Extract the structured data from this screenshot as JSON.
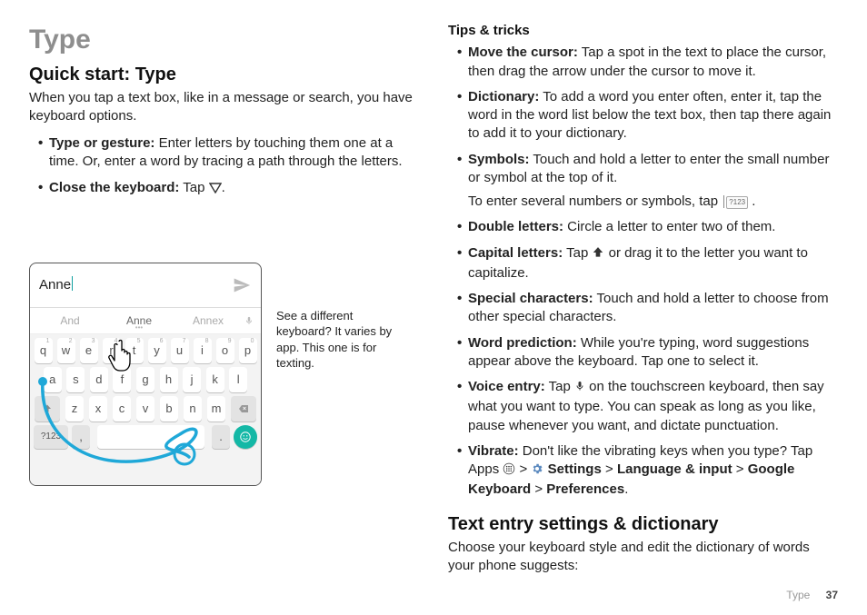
{
  "page_section": "Type",
  "page_number": "37",
  "left": {
    "title": "Type",
    "quick_start_heading": "Quick start: Type",
    "quick_start_body": "When you tap a text box, like in a message or search, you have keyboard options.",
    "bullets": [
      {
        "bold": "Type or gesture:",
        "rest": " Enter letters by touching them one at a time. Or, enter a word by tracing a path through the letters."
      },
      {
        "bold": "Close the keyboard:",
        "rest": " Tap "
      }
    ],
    "caption": "See a different keyboard? It varies by app. This one is for texting.",
    "keyboard": {
      "input_text": "Anne",
      "suggestions": [
        "And",
        "Anne",
        "Annex"
      ],
      "row1": [
        {
          "k": "q",
          "n": "1"
        },
        {
          "k": "w",
          "n": "2"
        },
        {
          "k": "e",
          "n": "3"
        },
        {
          "k": "r",
          "n": "4"
        },
        {
          "k": "t",
          "n": "5"
        },
        {
          "k": "y",
          "n": "6"
        },
        {
          "k": "u",
          "n": "7"
        },
        {
          "k": "i",
          "n": "8"
        },
        {
          "k": "o",
          "n": "9"
        },
        {
          "k": "p",
          "n": "0"
        }
      ],
      "row2": [
        "a",
        "s",
        "d",
        "f",
        "g",
        "h",
        "j",
        "k",
        "l"
      ],
      "row3": [
        "z",
        "x",
        "c",
        "v",
        "b",
        "n",
        "m"
      ],
      "sym_key": "?123"
    }
  },
  "right": {
    "tips_heading": "Tips & tricks",
    "tips": [
      {
        "bold": "Move the cursor:",
        "rest": " Tap a spot in the text to place the cursor, then drag the arrow under the cursor to move it."
      },
      {
        "bold": "Dictionary:",
        "rest": " To add a word you enter often, enter it, tap the word in the word list below the text box, then tap there again to add it to your dictionary."
      },
      {
        "bold": "Symbols:",
        "rest": " Touch and hold a letter to enter the small number or symbol at the top of it.",
        "extra": "To enter several numbers or symbols, tap ",
        "extra_key": "?123",
        "extra_after": " ."
      },
      {
        "bold": "Double letters:",
        "rest": " Circle a letter to enter two of them."
      },
      {
        "bold": "Capital letters:",
        "rest_pre": " Tap ",
        "rest_post": " or drag it to the letter you want to capitalize.",
        "icon": "shift"
      },
      {
        "bold": "Special characters:",
        "rest": " Touch and hold a letter to choose from other special characters."
      },
      {
        "bold": "Word prediction:",
        "rest": " While you're typing, word suggestions appear above the keyboard. Tap one to select it."
      },
      {
        "bold": "Voice entry:",
        "rest_pre": " Tap ",
        "rest_post": " on the touchscreen keyboard, then say what you want to type. You can speak as long as you like, pause whenever you want, and dictate punctuation.",
        "icon": "mic"
      },
      {
        "bold": "Vibrate:",
        "rest": " Don't like the vibrating keys when you type? Tap Apps ",
        "path": {
          "settings": "Settings",
          "lang": "Language & input",
          "gk": "Google Keyboard",
          "pref": "Preferences"
        }
      }
    ],
    "text_entry_heading": "Text entry settings & dictionary",
    "text_entry_body": "Choose your keyboard style and edit the dictionary of words your phone suggests:"
  }
}
